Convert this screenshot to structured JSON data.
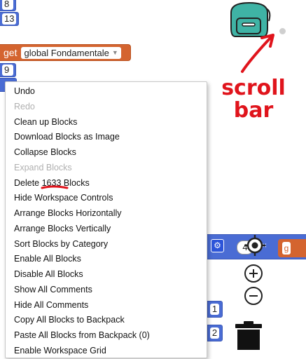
{
  "workspace": {
    "number_blocks": [
      "8",
      "13",
      "9"
    ],
    "get_block": {
      "keyword": "get",
      "variable": "global Fondamentale"
    },
    "right_blocks": {
      "value_top": "4",
      "x_mark": "×",
      "side_values": [
        "1",
        "2"
      ]
    }
  },
  "annotation": {
    "text_line1": "scroll",
    "text_line2": "bar",
    "color": "#e0141c"
  },
  "context_menu": {
    "items": [
      {
        "label": "Undo",
        "enabled": true
      },
      {
        "label": "Redo",
        "enabled": false
      },
      {
        "label": "Clean up Blocks",
        "enabled": true
      },
      {
        "label": "Download Blocks as Image",
        "enabled": true
      },
      {
        "label": "Collapse Blocks",
        "enabled": true
      },
      {
        "label": "Expand Blocks",
        "enabled": false
      },
      {
        "label": "Delete 1633 Blocks",
        "enabled": true
      },
      {
        "label": "Hide Workspace Controls",
        "enabled": true
      },
      {
        "label": "Arrange Blocks Horizontally",
        "enabled": true
      },
      {
        "label": "Arrange Blocks Vertically",
        "enabled": true
      },
      {
        "label": "Sort Blocks by Category",
        "enabled": true
      },
      {
        "label": "Enable All Blocks",
        "enabled": true
      },
      {
        "label": "Disable All Blocks",
        "enabled": true
      },
      {
        "label": "Show All Comments",
        "enabled": true
      },
      {
        "label": "Hide All Comments",
        "enabled": true
      },
      {
        "label": "Copy All Blocks to Backpack",
        "enabled": true
      },
      {
        "label": "Paste All Blocks from Backpack (0)",
        "enabled": true
      },
      {
        "label": "Enable Workspace Grid",
        "enabled": true
      }
    ]
  },
  "colors": {
    "block_blue": "#4a6cd4",
    "block_orange": "#d4642f",
    "backpack_teal": "#3fb3a5"
  },
  "icons": {
    "backpack": "backpack-icon",
    "trash": "trash-icon",
    "recenter": "crosshair-icon",
    "zoom_in": "plus-circle-icon",
    "zoom_out": "minus-circle-icon",
    "gear": "gear-icon"
  }
}
